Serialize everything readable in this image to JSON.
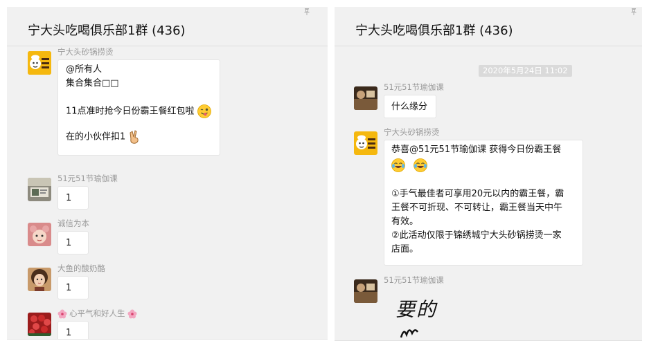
{
  "left": {
    "title": "宁大头吃喝俱乐部1群 (436)",
    "messages": [
      {
        "sender": "宁大头砂锅捞烫",
        "lines": [
          "@所有人",
          "集合集合□□",
          "11点准时抢今日份霸王餐红包啦",
          "在的小伙伴扣1"
        ]
      },
      {
        "sender": "51元51节瑜伽课",
        "text": "1"
      },
      {
        "sender": "诚信为本",
        "text": "1"
      },
      {
        "sender": "大鱼的酸奶酪",
        "text": "1"
      },
      {
        "sender": "心平气和好人生",
        "text": "1"
      }
    ]
  },
  "right": {
    "title": "宁大头吃喝俱乐部1群 (436)",
    "timestamp": "2020年5月24日 11:02",
    "messages": [
      {
        "sender": "51元51节瑜伽课",
        "text": "什么缘分"
      },
      {
        "sender": "宁大头砂锅捞烫",
        "lines": [
          "恭喜@51元51节瑜伽课 获得今日份霸王餐",
          "①手气最佳者可享用20元以内的霸王餐，霸",
          "王餐不可折现、不可转让，霸王餐当天中午",
          "有效。",
          "②此活动仅限于锦绣城宁大头砂锅捞烫一家",
          "店面。"
        ]
      },
      {
        "sender": "51元51节瑜伽课",
        "sticker_text": "要的"
      }
    ]
  },
  "icons": {
    "pin": "pin-icon",
    "wink_emoji": "winking-tongue-emoji-icon",
    "victory_hand": "victory-hand-icon",
    "tears_of_joy": "tears-of-joy-emoji-icon",
    "flower": "cherry-blossom-icon"
  },
  "colors": {
    "panel_bg": "#f1f1f1",
    "bubble_bg": "#ffffff",
    "sender_text": "#9a9a9a",
    "timestamp_bg": "#dadada"
  }
}
